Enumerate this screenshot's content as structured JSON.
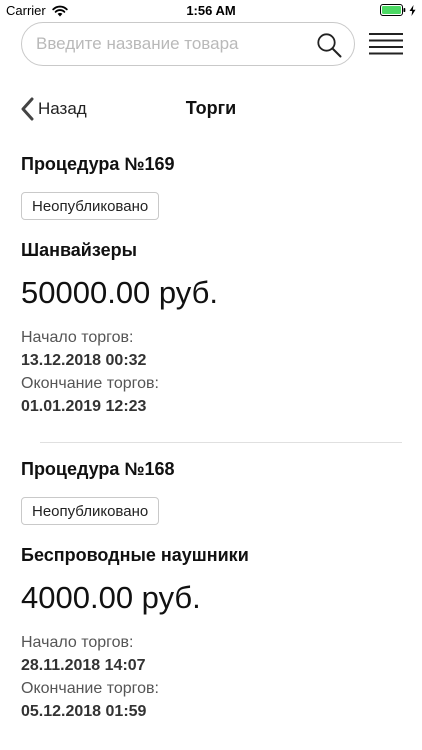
{
  "status_bar": {
    "carrier": "Carrier",
    "time": "1:56 AM",
    "battery_color": "#4cd964"
  },
  "search": {
    "placeholder": "Введите название товара",
    "value": ""
  },
  "nav": {
    "back_label": "Назад",
    "title": "Торги"
  },
  "procedures": [
    {
      "title": "Процедура №169",
      "status": "Неопубликовано",
      "product": "Шанвайзеры",
      "price": "50000.00 руб.",
      "start_label": "Начало торгов:",
      "start_value": "13.12.2018 00:32",
      "end_label": "Окончание торгов:",
      "end_value": "01.01.2019 12:23"
    },
    {
      "title": "Процедура №168",
      "status": "Неопубликовано",
      "product": "Беспроводные наушники",
      "price": "4000.00 руб.",
      "start_label": "Начало торгов:",
      "start_value": "28.11.2018 14:07",
      "end_label": "Окончание торгов:",
      "end_value": "05.12.2018 01:59"
    }
  ],
  "icons": {
    "search": "search-icon",
    "menu": "hamburger-menu-icon",
    "back": "chevron-left-icon",
    "wifi": "wifi-icon",
    "battery": "battery-icon"
  }
}
